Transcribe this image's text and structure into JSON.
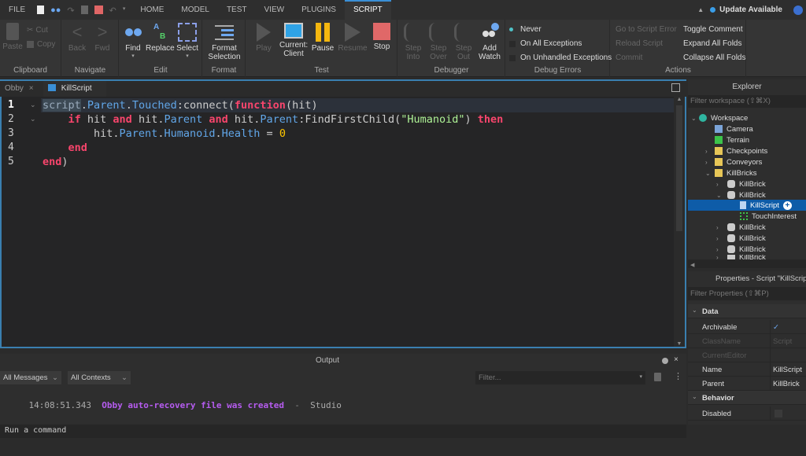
{
  "menubar": {
    "file": "FILE",
    "tabs": [
      "HOME",
      "MODEL",
      "TEST",
      "VIEW",
      "PLUGINS",
      "SCRIPT"
    ],
    "active_tab": "SCRIPT",
    "update": "Update Available"
  },
  "ribbon": {
    "clipboard": {
      "label": "Clipboard",
      "paste": "Paste",
      "cut": "Cut",
      "copy": "Copy"
    },
    "navigate": {
      "label": "Navigate",
      "back": "Back",
      "fwd": "Fwd"
    },
    "edit": {
      "label": "Edit",
      "find": "Find",
      "replace": "Replace",
      "select": "Select"
    },
    "format": {
      "label": "Format",
      "format_selection": "Format Selection"
    },
    "test": {
      "label": "Test",
      "play": "Play",
      "current": "Current:",
      "client": "Client",
      "pause": "Pause",
      "resume": "Resume",
      "stop": "Stop"
    },
    "debugger": {
      "label": "Debugger",
      "step_into_1": "Step",
      "step_into_2": "Into",
      "step_over_1": "Step",
      "step_over_2": "Over",
      "step_out_1": "Step",
      "step_out_2": "Out",
      "add_watch_1": "Add",
      "add_watch_2": "Watch"
    },
    "debug_errors": {
      "label": "Debug Errors",
      "options": [
        "Never",
        "On All Exceptions",
        "On Unhandled Exceptions"
      ],
      "selected": "Never"
    },
    "actions": {
      "label": "Actions",
      "go_to_error": "Go to Script Error",
      "reload": "Reload Script",
      "commit": "Commit",
      "toggle_comment": "Toggle Comment",
      "expand": "Expand All Folds",
      "collapse": "Collapse All Folds"
    }
  },
  "editor": {
    "tabs": [
      {
        "label": "Obby"
      },
      {
        "label": "KillScript"
      }
    ],
    "active_tab": "KillScript",
    "line_numbers": [
      "1",
      "2",
      "3",
      "4",
      "5"
    ],
    "code": {
      "l1": [
        "script",
        ".",
        "Parent",
        ".",
        "Touched",
        ":connect(",
        "function",
        "(hit)"
      ],
      "l2": [
        "if",
        " hit ",
        "and",
        " hit.",
        "Parent",
        " ",
        "and",
        " hit.",
        "Parent",
        ":FindFirstChild(",
        "\"Humanoid\"",
        ") ",
        "then"
      ],
      "l3": [
        "hit.",
        "Parent",
        ".",
        "Humanoid",
        ".",
        "Health",
        " = ",
        "0"
      ],
      "l4": [
        "end"
      ],
      "l5": [
        "end",
        ")"
      ]
    }
  },
  "explorer": {
    "title": "Explorer",
    "filter_placeholder": "Filter workspace (⇧⌘X)",
    "items": [
      {
        "label": "Workspace"
      },
      {
        "label": "Camera"
      },
      {
        "label": "Terrain"
      },
      {
        "label": "Checkpoints"
      },
      {
        "label": "Conveyors"
      },
      {
        "label": "KillBricks"
      },
      {
        "label": "KillBrick"
      },
      {
        "label": "KillBrick"
      },
      {
        "label": "KillScript"
      },
      {
        "label": "TouchInterest"
      },
      {
        "label": "KillBrick"
      },
      {
        "label": "KillBrick"
      },
      {
        "label": "KillBrick"
      },
      {
        "label": "KillBrick"
      }
    ],
    "selected": "KillScript"
  },
  "properties": {
    "title": "Properties - Script \"KillScript\"",
    "filter_placeholder": "Filter Properties (⇧⌘P)",
    "sections": {
      "data": "Data",
      "behavior": "Behavior"
    },
    "rows": [
      {
        "key": "Archivable",
        "value": "✓"
      },
      {
        "key": "ClassName",
        "value": "Script"
      },
      {
        "key": "CurrentEditor",
        "value": ""
      },
      {
        "key": "Name",
        "value": "KillScript"
      },
      {
        "key": "Parent",
        "value": "KillBrick"
      },
      {
        "key": "Disabled",
        "value": ""
      }
    ]
  },
  "output": {
    "title": "Output",
    "messages_filter": "All Messages",
    "contexts_filter": "All Contexts",
    "filter_placeholder": "Filter...",
    "log": [
      {
        "time": "14:08:51.343",
        "message": "Obby auto-recovery file was created",
        "sep": "-",
        "source": "Studio"
      }
    ]
  },
  "command_bar": {
    "placeholder": "Run a command"
  },
  "colors": {
    "accent": "#3a8fd6",
    "keyword": "#f8456c",
    "property": "#61a6e8",
    "string": "#adf195",
    "number": "#ffc600",
    "log_message": "#b65cf0",
    "selected": "#0e5ca8"
  }
}
